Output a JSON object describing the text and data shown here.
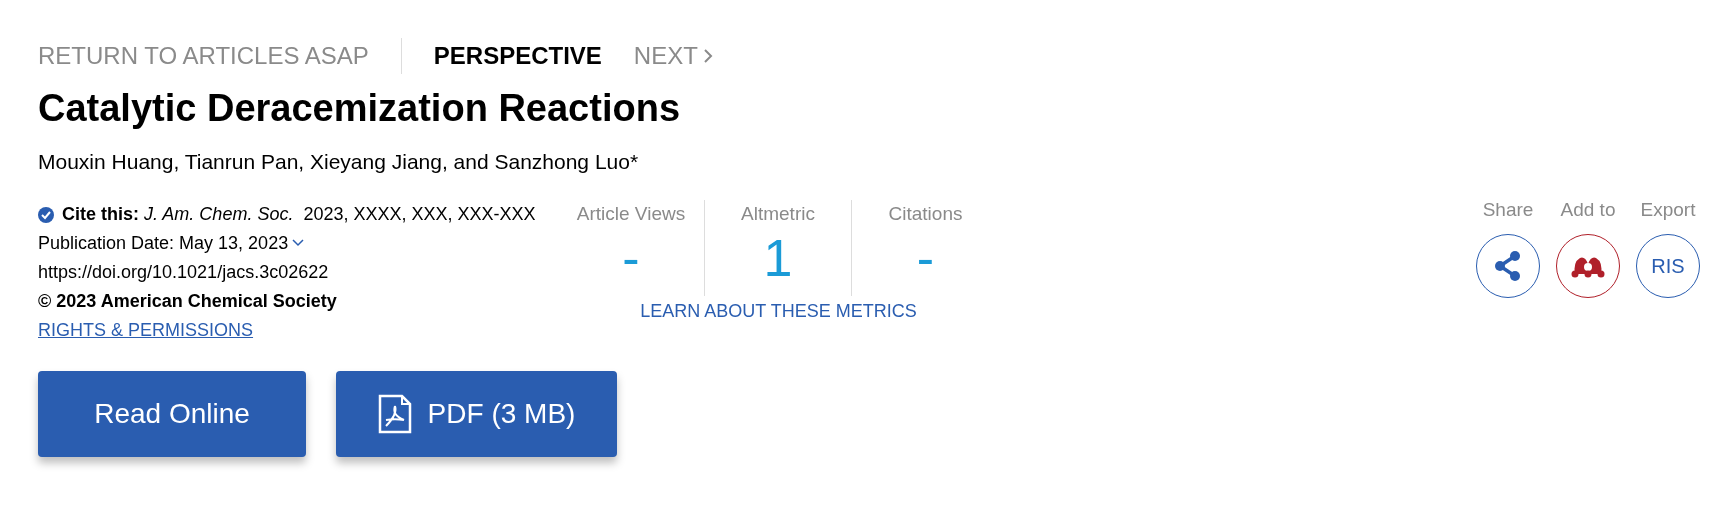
{
  "nav": [
    {
      "kind": "link",
      "label": "RETURN TO ARTICLES ASAP"
    },
    {
      "kind": "current",
      "label": "PERSPECTIVE"
    },
    {
      "kind": "next",
      "label": "NEXT"
    }
  ],
  "title": "Catalytic Deracemization Reactions",
  "authors": "Mouxin Huang, Tianrun Pan, Xieyang Jiang, and Sanzhong Luo*",
  "citation": {
    "cite": "**Cite this:** *J. Am. Chem. Soc.*  2023, XXXX, XXX, XXX-XXX",
    "publication_date": "Publication Date: May 13, 2023",
    "doi": "https://doi.org/10.1021/jacs.3c02622",
    "copyright": "© 2023 American Chemical Society",
    "rights_link": "RIGHTS & PERMISSIONS"
  },
  "metrics": [
    {
      "label": "Article Views",
      "value": "-"
    },
    {
      "label": "Altmetric",
      "value": "1"
    },
    {
      "label": "Citations",
      "value": "-"
    }
  ],
  "metrics_link": "LEARN ABOUT THESE METRICS",
  "actions": [
    {
      "kind": "share",
      "label": "Share"
    },
    {
      "kind": "mendeley",
      "label": "Add to"
    },
    {
      "kind": "ris",
      "label": "Export",
      "text": "RIS"
    }
  ],
  "buttons": [
    {
      "kind": "read",
      "label": "Read Online"
    },
    {
      "kind": "pdf",
      "label": "PDF (3 MB)"
    }
  ]
}
